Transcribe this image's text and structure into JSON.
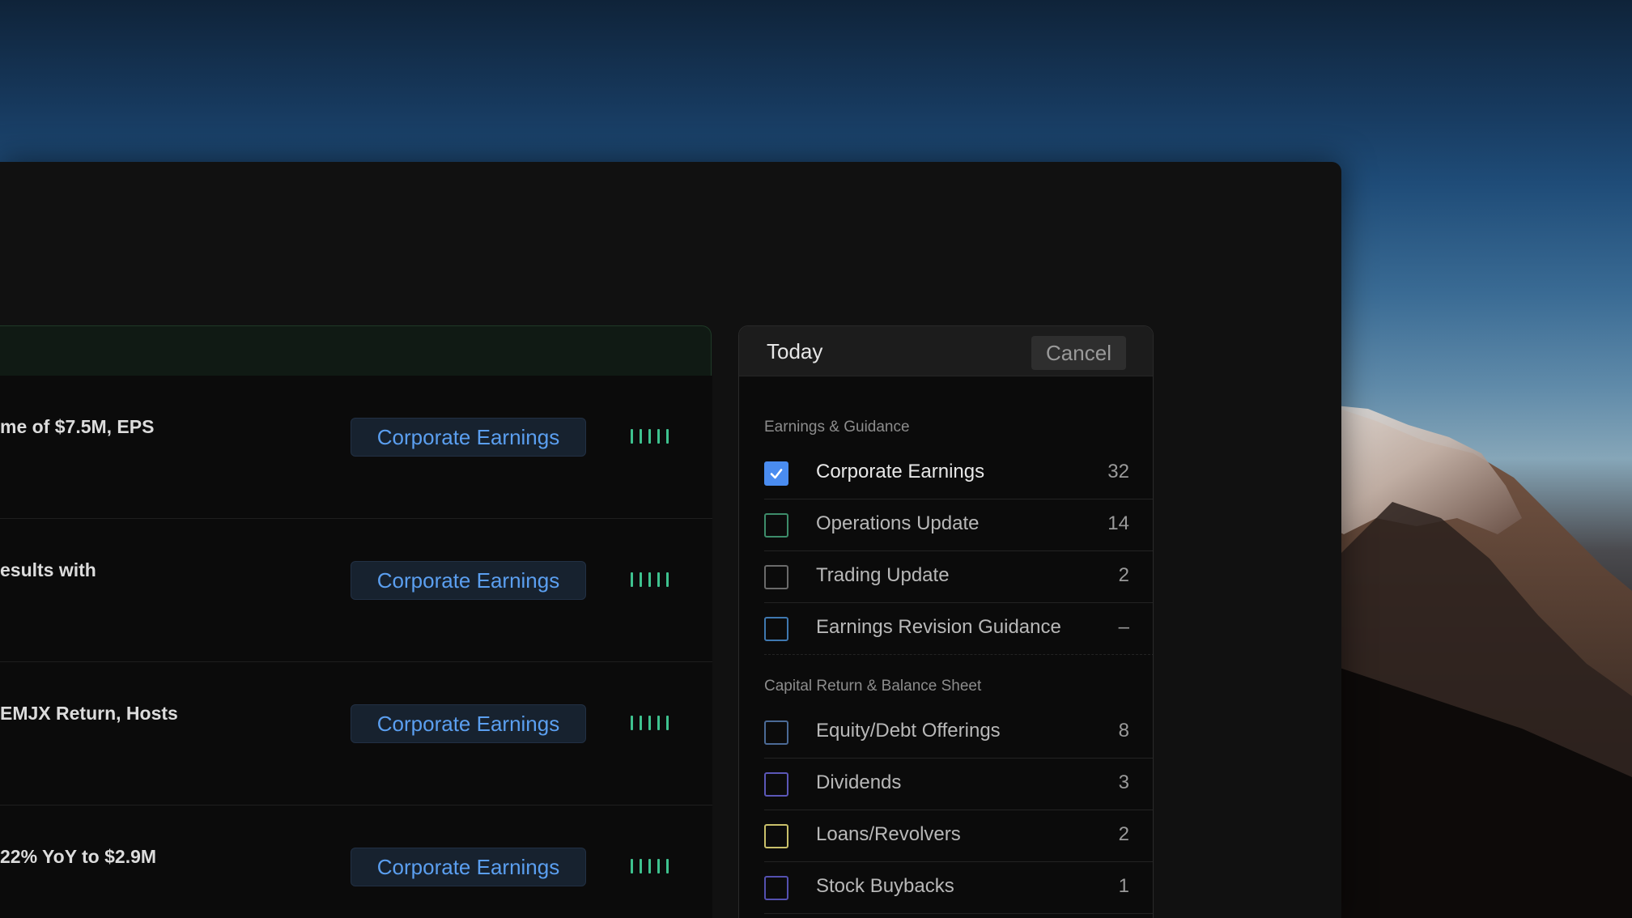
{
  "rows": [
    {
      "title": "me of $7.5M, EPS",
      "tag": "Corporate Earnings"
    },
    {
      "title": "esults with",
      "tag": "Corporate Earnings"
    },
    {
      "title": "EMJX Return, Hosts",
      "tag": "Corporate Earnings"
    },
    {
      "title": "22% YoY to $2.9M",
      "tag": "Corporate Earnings"
    }
  ],
  "filter": {
    "title": "Today",
    "cancel_label": "Cancel",
    "sections": [
      {
        "label": "Earnings & Guidance",
        "options": [
          {
            "label": "Corporate Earnings",
            "count": "32",
            "checked": true,
            "color": "#4a8cf0"
          },
          {
            "label": "Operations Update",
            "count": "14",
            "checked": false,
            "color": "#3d8c6a"
          },
          {
            "label": "Trading Update",
            "count": "2",
            "checked": false,
            "color": "#6a6a6a"
          },
          {
            "label": "Earnings Revision Guidance",
            "count": "–",
            "checked": false,
            "color": "#3f78b0"
          }
        ]
      },
      {
        "label": "Capital Return & Balance Sheet",
        "options": [
          {
            "label": "Equity/Debt Offerings",
            "count": "8",
            "checked": false,
            "color": "#4b6a96"
          },
          {
            "label": "Dividends",
            "count": "3",
            "checked": false,
            "color": "#5b57b8"
          },
          {
            "label": "Loans/Revolvers",
            "count": "2",
            "checked": false,
            "color": "#c9c06a"
          },
          {
            "label": "Stock Buybacks",
            "count": "1",
            "checked": false,
            "color": "#5450b0"
          }
        ]
      }
    ]
  },
  "colors": {
    "accent": "#4a8cf0",
    "tag_text": "#5b9ff0",
    "signal_bars": "#3ec28f"
  },
  "icons": {
    "checkbox_check": "check-icon",
    "signal": "signal-bars-icon"
  }
}
